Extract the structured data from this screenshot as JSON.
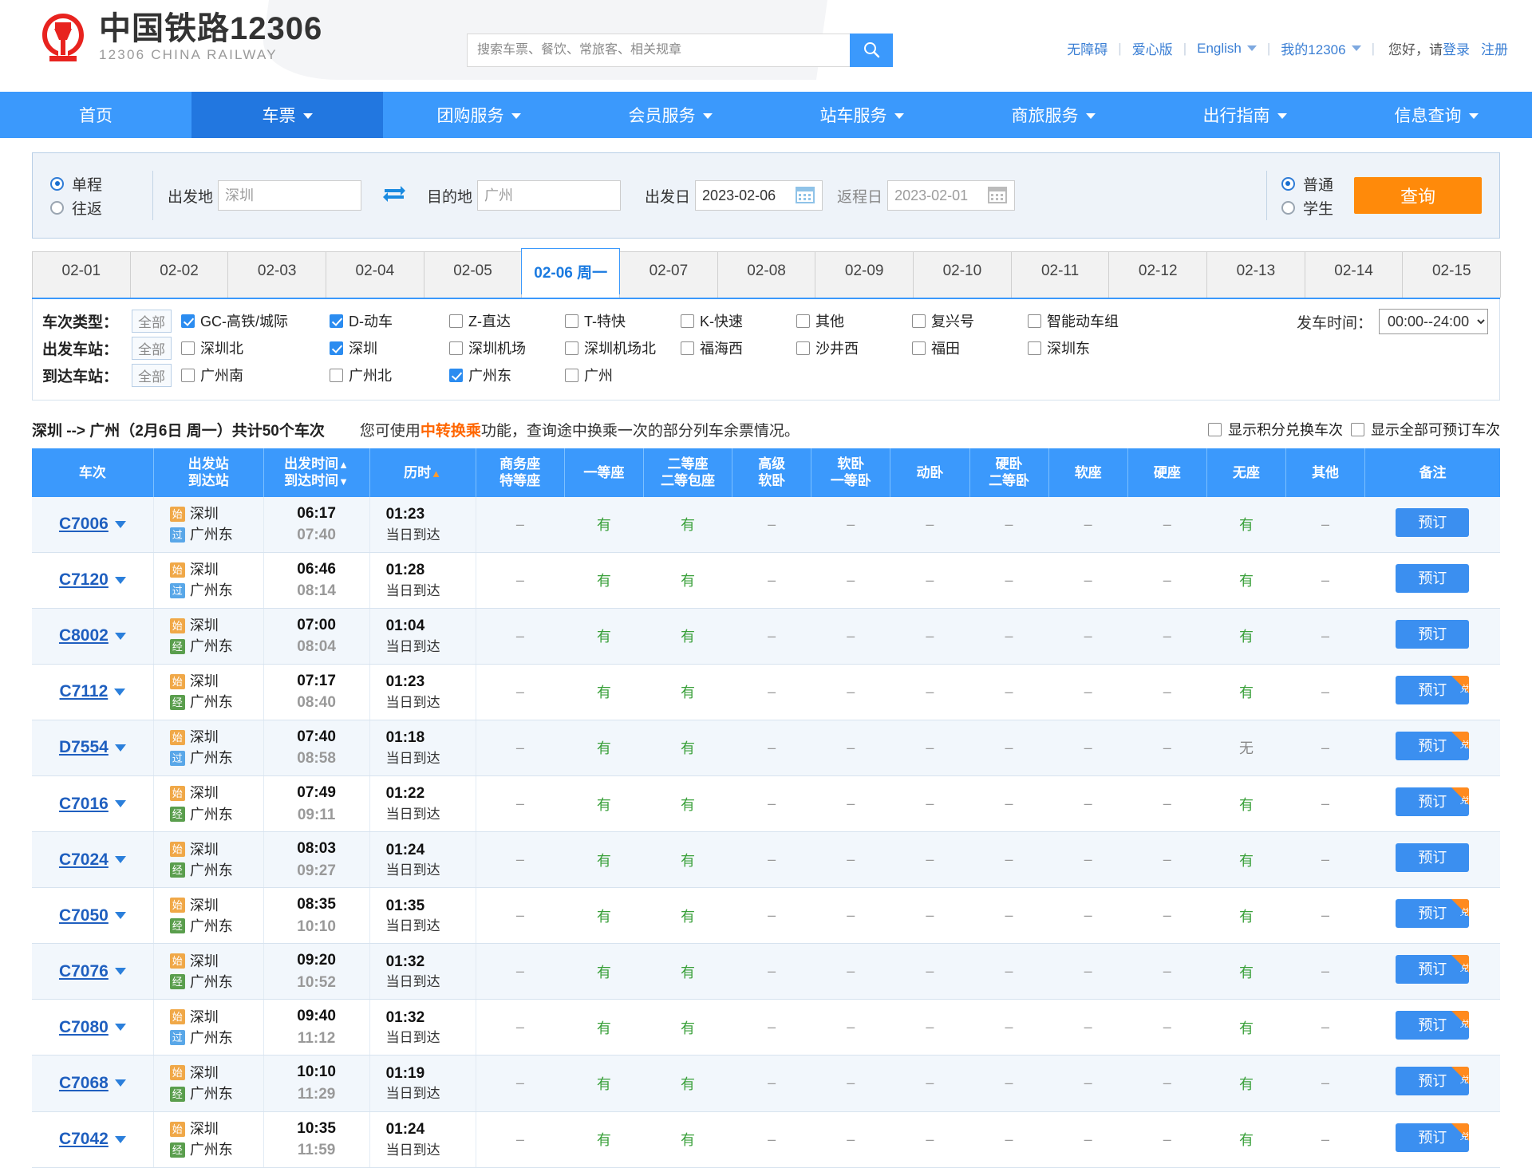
{
  "brand": {
    "name_cn": "中国铁路12306",
    "name_en": "12306 CHINA RAILWAY"
  },
  "search": {
    "placeholder": "搜索车票、餐饮、常旅客、相关规章",
    "value": "",
    "icon": "search-icon"
  },
  "header_links": {
    "accessibility": "无障碍",
    "care_version": "爱心版",
    "english": "English",
    "my12306": "我的12306",
    "greeting": "您好，请",
    "login": "登录",
    "register": "注册"
  },
  "nav": {
    "items": [
      {
        "label": "首页",
        "caret": false,
        "active": false
      },
      {
        "label": "车票",
        "caret": true,
        "active": true
      },
      {
        "label": "团购服务",
        "caret": true,
        "active": false
      },
      {
        "label": "会员服务",
        "caret": true,
        "active": false
      },
      {
        "label": "站车服务",
        "caret": true,
        "active": false
      },
      {
        "label": "商旅服务",
        "caret": true,
        "active": false
      },
      {
        "label": "出行指南",
        "caret": true,
        "active": false
      },
      {
        "label": "信息查询",
        "caret": true,
        "active": false
      }
    ]
  },
  "form": {
    "trip_oneway": "单程",
    "trip_round": "往返",
    "trip_selected": "单程",
    "from_label": "出发地",
    "from_value": "",
    "from_placeholder": "深圳",
    "to_label": "目的地",
    "to_value": "",
    "to_placeholder": "广州",
    "swap_icon": "swap-arrows-icon",
    "depart_label": "出发日",
    "depart_value": "2023-02-06",
    "return_label": "返程日",
    "return_value": "",
    "return_placeholder": "2023-02-01",
    "calendar_icon": "calendar-icon",
    "type_normal": "普通",
    "type_student": "学生",
    "type_selected": "普通",
    "query_button": "查询"
  },
  "date_tabs": {
    "items": [
      "02-01",
      "02-02",
      "02-03",
      "02-04",
      "02-05",
      "02-06 周一",
      "02-07",
      "02-08",
      "02-09",
      "02-10",
      "02-11",
      "02-12",
      "02-13",
      "02-14",
      "02-15"
    ],
    "active_index": 5
  },
  "filters": {
    "all_label": "全部",
    "rows": [
      {
        "label": "车次类型：",
        "options": [
          {
            "label": "GC-高铁/城际",
            "checked": true
          },
          {
            "label": "D-动车",
            "checked": true
          },
          {
            "label": "Z-直达",
            "checked": false
          },
          {
            "label": "T-特快",
            "checked": false
          },
          {
            "label": "K-快速",
            "checked": false
          },
          {
            "label": "其他",
            "checked": false
          },
          {
            "label": "复兴号",
            "checked": false
          },
          {
            "label": "智能动车组",
            "checked": false
          }
        ]
      },
      {
        "label": "出发车站：",
        "options": [
          {
            "label": "深圳北",
            "checked": false
          },
          {
            "label": "深圳",
            "checked": true
          },
          {
            "label": "深圳机场",
            "checked": false
          },
          {
            "label": "深圳机场北",
            "checked": false
          },
          {
            "label": "福海西",
            "checked": false
          },
          {
            "label": "沙井西",
            "checked": false
          },
          {
            "label": "福田",
            "checked": false
          },
          {
            "label": "深圳东",
            "checked": false
          }
        ]
      },
      {
        "label": "到达车站：",
        "options": [
          {
            "label": "广州南",
            "checked": false
          },
          {
            "label": "广州北",
            "checked": false
          },
          {
            "label": "广州东",
            "checked": true
          },
          {
            "label": "广州",
            "checked": false
          }
        ]
      }
    ],
    "depart_time_label": "发车时间：",
    "depart_time_value": "00:00--24:00"
  },
  "summary": {
    "route": "深圳 --> 广州（2月6日 周一）共计50个车次",
    "note_pre": "您可使用",
    "note_link": "中转换乘",
    "note_post": "功能，查询途中换乘一次的部分列车余票情况。",
    "show_points": "显示积分兑换车次",
    "show_all": "显示全部可预订车次"
  },
  "table": {
    "headers": [
      {
        "line1": "车次",
        "line2": "",
        "sort": ""
      },
      {
        "line1": "出发站",
        "line2": "到达站",
        "sort": ""
      },
      {
        "line1": "出发时间",
        "line2": "到达时间",
        "sort": "both"
      },
      {
        "line1": "历时",
        "line2": "",
        "sort": "asc"
      },
      {
        "line1": "商务座",
        "line2": "特等座",
        "sort": ""
      },
      {
        "line1": "一等座",
        "line2": "",
        "sort": ""
      },
      {
        "line1": "二等座",
        "line2": "二等包座",
        "sort": ""
      },
      {
        "line1": "高级",
        "line2": "软卧",
        "sort": ""
      },
      {
        "line1": "软卧",
        "line2": "一等卧",
        "sort": ""
      },
      {
        "line1": "动卧",
        "line2": "",
        "sort": ""
      },
      {
        "line1": "硬卧",
        "line2": "二等卧",
        "sort": ""
      },
      {
        "line1": "软座",
        "line2": "",
        "sort": ""
      },
      {
        "line1": "硬座",
        "line2": "",
        "sort": ""
      },
      {
        "line1": "无座",
        "line2": "",
        "sort": ""
      },
      {
        "line1": "其他",
        "line2": "",
        "sort": ""
      },
      {
        "line1": "备注",
        "line2": "",
        "sort": ""
      }
    ],
    "book_label": "预订",
    "corner_label": "兑",
    "arrive_same_day": "当日到达",
    "rows": [
      {
        "code": "C7006",
        "from_badge": "始",
        "from": "深圳",
        "to_badge": "过",
        "to": "广州东",
        "dep": "06:17",
        "arr": "07:40",
        "dur": "01:23",
        "seats": [
          "–",
          "有",
          "有",
          "–",
          "–",
          "–",
          "–",
          "–",
          "–",
          "有",
          "–"
        ],
        "corner": false
      },
      {
        "code": "C7120",
        "from_badge": "始",
        "from": "深圳",
        "to_badge": "过",
        "to": "广州东",
        "dep": "06:46",
        "arr": "08:14",
        "dur": "01:28",
        "seats": [
          "–",
          "有",
          "有",
          "–",
          "–",
          "–",
          "–",
          "–",
          "–",
          "有",
          "–"
        ],
        "corner": false
      },
      {
        "code": "C8002",
        "from_badge": "始",
        "from": "深圳",
        "to_badge": "经",
        "to": "广州东",
        "dep": "07:00",
        "arr": "08:04",
        "dur": "01:04",
        "seats": [
          "–",
          "有",
          "有",
          "–",
          "–",
          "–",
          "–",
          "–",
          "–",
          "有",
          "–"
        ],
        "corner": false
      },
      {
        "code": "C7112",
        "from_badge": "始",
        "from": "深圳",
        "to_badge": "经",
        "to": "广州东",
        "dep": "07:17",
        "arr": "08:40",
        "dur": "01:23",
        "seats": [
          "–",
          "有",
          "有",
          "–",
          "–",
          "–",
          "–",
          "–",
          "–",
          "有",
          "–"
        ],
        "corner": true
      },
      {
        "code": "D7554",
        "from_badge": "始",
        "from": "深圳",
        "to_badge": "过",
        "to": "广州东",
        "dep": "07:40",
        "arr": "08:58",
        "dur": "01:18",
        "seats": [
          "–",
          "有",
          "有",
          "–",
          "–",
          "–",
          "–",
          "–",
          "–",
          "无",
          "–"
        ],
        "corner": true
      },
      {
        "code": "C7016",
        "from_badge": "始",
        "from": "深圳",
        "to_badge": "经",
        "to": "广州东",
        "dep": "07:49",
        "arr": "09:11",
        "dur": "01:22",
        "seats": [
          "–",
          "有",
          "有",
          "–",
          "–",
          "–",
          "–",
          "–",
          "–",
          "有",
          "–"
        ],
        "corner": true
      },
      {
        "code": "C7024",
        "from_badge": "始",
        "from": "深圳",
        "to_badge": "经",
        "to": "广州东",
        "dep": "08:03",
        "arr": "09:27",
        "dur": "01:24",
        "seats": [
          "–",
          "有",
          "有",
          "–",
          "–",
          "–",
          "–",
          "–",
          "–",
          "有",
          "–"
        ],
        "corner": false
      },
      {
        "code": "C7050",
        "from_badge": "始",
        "from": "深圳",
        "to_badge": "经",
        "to": "广州东",
        "dep": "08:35",
        "arr": "10:10",
        "dur": "01:35",
        "seats": [
          "–",
          "有",
          "有",
          "–",
          "–",
          "–",
          "–",
          "–",
          "–",
          "有",
          "–"
        ],
        "corner": true
      },
      {
        "code": "C7076",
        "from_badge": "始",
        "from": "深圳",
        "to_badge": "经",
        "to": "广州东",
        "dep": "09:20",
        "arr": "10:52",
        "dur": "01:32",
        "seats": [
          "–",
          "有",
          "有",
          "–",
          "–",
          "–",
          "–",
          "–",
          "–",
          "有",
          "–"
        ],
        "corner": true
      },
      {
        "code": "C7080",
        "from_badge": "始",
        "from": "深圳",
        "to_badge": "过",
        "to": "广州东",
        "dep": "09:40",
        "arr": "11:12",
        "dur": "01:32",
        "seats": [
          "–",
          "有",
          "有",
          "–",
          "–",
          "–",
          "–",
          "–",
          "–",
          "有",
          "–"
        ],
        "corner": true
      },
      {
        "code": "C7068",
        "from_badge": "始",
        "from": "深圳",
        "to_badge": "经",
        "to": "广州东",
        "dep": "10:10",
        "arr": "11:29",
        "dur": "01:19",
        "seats": [
          "–",
          "有",
          "有",
          "–",
          "–",
          "–",
          "–",
          "–",
          "–",
          "有",
          "–"
        ],
        "corner": true
      },
      {
        "code": "C7042",
        "from_badge": "始",
        "from": "深圳",
        "to_badge": "经",
        "to": "广州东",
        "dep": "10:35",
        "arr": "11:59",
        "dur": "01:24",
        "seats": [
          "–",
          "有",
          "有",
          "–",
          "–",
          "–",
          "–",
          "–",
          "–",
          "有",
          "–"
        ],
        "corner": true
      }
    ]
  }
}
